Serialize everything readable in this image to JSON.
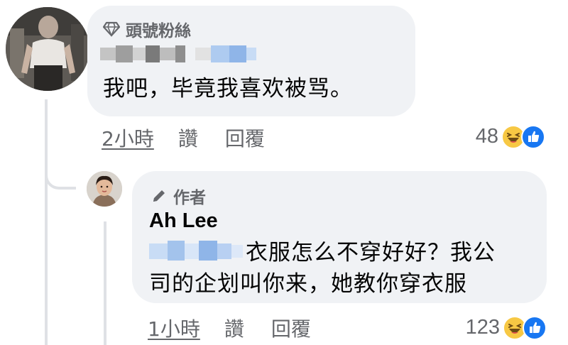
{
  "main_comment": {
    "badge_label": "頭號粉絲",
    "badge_icon": "diamond-icon",
    "name_blurred": true,
    "text": "我吧，毕竟我喜欢被骂。",
    "time": "2小時",
    "like_label": "讚",
    "reply_label": "回覆",
    "reaction_count": "48",
    "reactions": [
      "haha-icon",
      "like-icon"
    ]
  },
  "reply_comment": {
    "badge_label": "作者",
    "badge_icon": "pencil-icon",
    "author": "Ah Lee",
    "mention_blurred": true,
    "text_line1": "衣服怎么不穿好好？我公",
    "text_line2": "司的企划叫你来，她教你穿衣服",
    "time": "1小時",
    "like_label": "讚",
    "reply_label": "回覆",
    "reaction_count": "123",
    "reactions": [
      "haha-icon",
      "like-icon"
    ]
  },
  "colors": {
    "bubble_bg": "#f0f2f5",
    "meta_text": "#65676b",
    "like_blue": "#1877f2",
    "haha_yellow": "#f7c844",
    "thread_line": "#dfe1e5"
  }
}
